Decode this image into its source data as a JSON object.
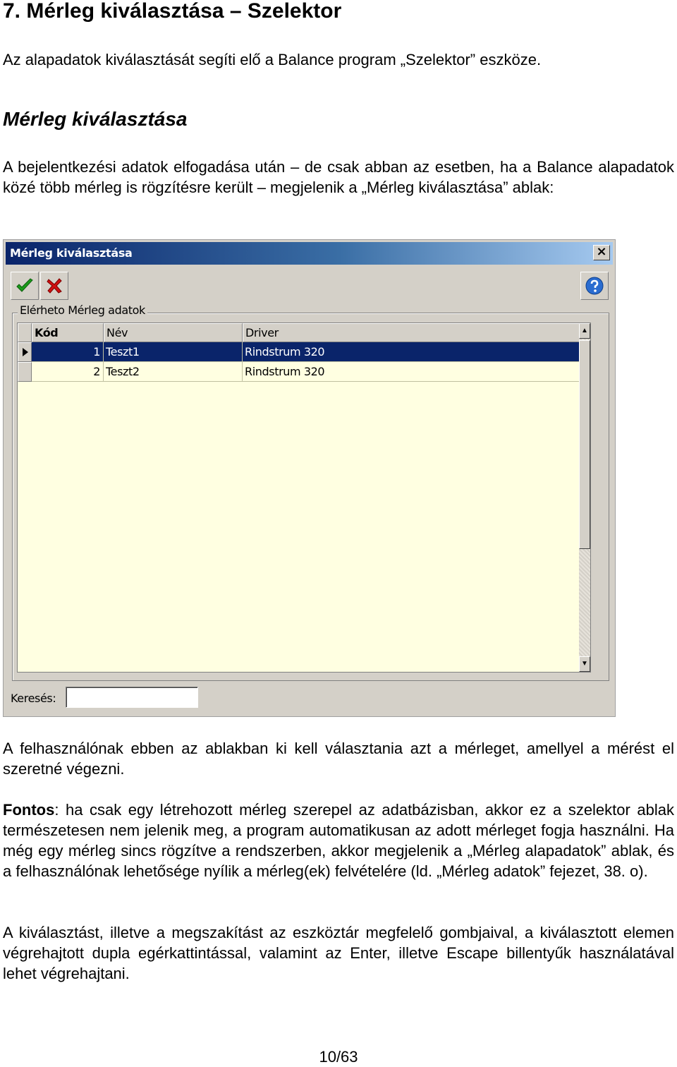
{
  "document": {
    "title": "7. Mérleg kiválasztása – Szelektor",
    "intro": "Az alapadatok kiválasztását segíti elő a Balance program „Szelektor” eszköze.",
    "section_title": "Mérleg kiválasztása",
    "para1": "A bejelentkezési adatok elfogadása után – de csak abban az esetben, ha a Balance alapadatok közé több mérleg is rögzítésre került – megjelenik a „Mérleg kiválasztása” ablak:",
    "para2": "A felhasználónak ebben az ablakban ki kell választania azt a mérleget, amellyel a mérést el szeretné végezni.",
    "para3_bold": "Fontos",
    "para3_rest": ": ha csak egy létrehozott mérleg szerepel az adatbázisban, akkor ez a szelektor ablak természetesen nem jelenik meg, a program automatikusan az adott mérleget fogja használni. Ha még egy mérleg sincs rögzítve a rendszerben, akkor megjelenik a „Mérleg alapadatok” ablak, és a felhasználónak lehetősége nyílik a mérleg(ek) felvételére (ld. „Mérleg adatok” fejezet, 38. o).",
    "para4": "A kiválasztást, illetve a megszakítást az eszköztár megfelelő gombjaival, a kiválasztott elemen végrehajtott dupla egérkattintással, valamint az Enter, illetve Escape billentyűk használatával lehet végrehajtani.",
    "page_number": "10/63"
  },
  "window": {
    "title": "Mérleg kiválasztása",
    "close_glyph": "×",
    "group_label": "Elérheto Mérleg adatok",
    "columns": [
      "Kód",
      "Név",
      "Driver"
    ],
    "rows": [
      {
        "kod": "1",
        "nev": "Teszt1",
        "driver": "Rindstrum 320"
      },
      {
        "kod": "2",
        "nev": "Teszt2",
        "driver": "Rindstrum 320"
      }
    ],
    "search_label": "Keresés:",
    "search_value": "",
    "scroll_up_glyph": "▲",
    "scroll_down_glyph": "▼",
    "icons": {
      "ok": "checkmark-icon",
      "cancel": "red-x-icon",
      "help": "help-icon",
      "row_indicator": "row-pointer-icon"
    },
    "colors": {
      "title_bar_start": "#0a246a",
      "title_bar_end": "#a6caf0",
      "selected_row": "#0a246a",
      "grid_background": "#ffffe1",
      "ok_icon": "#1a9b1a",
      "cancel_icon": "#d01010",
      "help_icon": "#2a6cd0"
    }
  }
}
